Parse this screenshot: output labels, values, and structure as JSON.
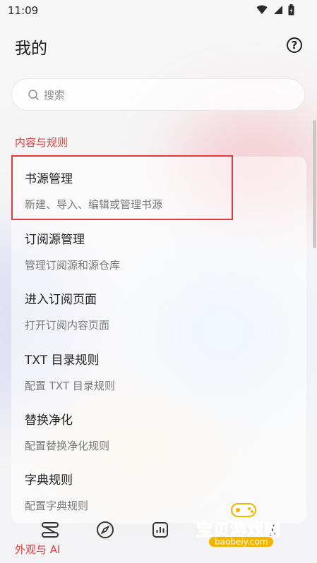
{
  "status": {
    "time": "11:09"
  },
  "header": {
    "title": "我的"
  },
  "search": {
    "placeholder": "搜索"
  },
  "section": {
    "label": "内容与规则"
  },
  "items": [
    {
      "title": "书源管理",
      "desc": "新建、导入、编辑或管理书源"
    },
    {
      "title": "订阅源管理",
      "desc": "管理订阅源和源仓库"
    },
    {
      "title": "进入订阅页面",
      "desc": "打开订阅内容页面"
    },
    {
      "title": "TXT 目录规则",
      "desc": "配置 TXT 目录规则"
    },
    {
      "title": "替换净化",
      "desc": "配置替换净化规则"
    },
    {
      "title": "字典规则",
      "desc": "配置字典规则"
    }
  ],
  "bottom_section": {
    "label": "外观与 AI"
  },
  "watermark": {
    "text": "宝贝游戏网",
    "sub": "baobeiy.com"
  },
  "colors": {
    "accent": "#e33c3c",
    "highlight": "#e23a3a"
  },
  "icons": [
    "wifi-icon",
    "signal-icon",
    "battery-icon",
    "help-icon",
    "search-icon",
    "bookshelf-icon",
    "explore-icon",
    "chart-icon",
    "my-icon"
  ]
}
